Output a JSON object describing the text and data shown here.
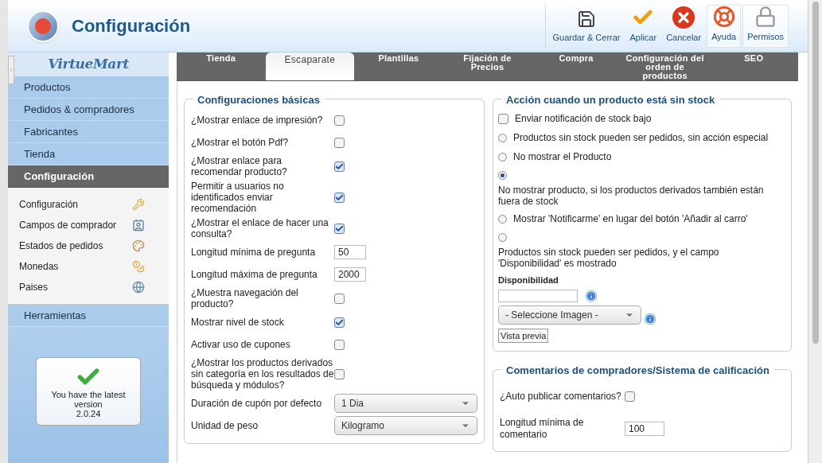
{
  "header": {
    "title": "Configuración",
    "toolbar": [
      {
        "label": "Guardar & Cerrar",
        "kind": "save"
      },
      {
        "label": "Aplicar",
        "kind": "apply"
      },
      {
        "label": "Cancelar",
        "kind": "cancel"
      },
      {
        "label": "Ayuda",
        "kind": "help"
      },
      {
        "label": "Permisos",
        "kind": "permissions"
      }
    ]
  },
  "sidebar": {
    "logo": "VirtueMart",
    "menu": [
      {
        "label": "Productos",
        "selected": false
      },
      {
        "label": "Pedidos & compradores",
        "selected": false
      },
      {
        "label": "Fabricantes",
        "selected": false
      },
      {
        "label": "Tienda",
        "selected": false
      },
      {
        "label": "Configuración",
        "selected": true,
        "children": [
          {
            "label": "Configuración",
            "kind": "tools"
          },
          {
            "label": "Campos de comprador",
            "kind": "users"
          },
          {
            "label": "Estados de pedidos",
            "kind": "status"
          },
          {
            "label": "Monedas",
            "kind": "coins"
          },
          {
            "label": "Paises",
            "kind": "globe"
          }
        ]
      },
      {
        "label": "Herramientas",
        "selected": false
      }
    ],
    "version": {
      "message": "You have the latest version",
      "number": "2.0.24"
    }
  },
  "tabs": [
    {
      "label": "Tienda",
      "selected": false
    },
    {
      "label": "Escaparate",
      "selected": true
    },
    {
      "label": "Plantillas",
      "selected": false
    },
    {
      "label": "Fijación de Precios",
      "selected": false
    },
    {
      "label": "Compra",
      "selected": false
    },
    {
      "label": "Configuración del orden de productos",
      "selected": false
    },
    {
      "label": "SEO",
      "selected": false
    }
  ],
  "basic": {
    "title": "Configuraciones básicas",
    "rows": [
      {
        "kind": "checkbox",
        "label": "¿Mostrar enlace de impresión?",
        "checked": false
      },
      {
        "kind": "checkbox",
        "label": "¿Mostrar el botón Pdf?",
        "checked": false
      },
      {
        "kind": "checkbox",
        "label": "¿Mostrar enlace para recomendar producto?",
        "checked": true
      },
      {
        "kind": "checkbox",
        "label": "Permitir a usuarios no identificados enviar recomendación",
        "checked": true
      },
      {
        "kind": "checkbox",
        "label": "¿Mostrar el enlace de hacer una consulta?",
        "checked": true
      },
      {
        "kind": "text",
        "label": "Longitud mínima de pregunta",
        "value": "50"
      },
      {
        "kind": "text",
        "label": "Longitud máxima de pregunta",
        "value": "2000"
      },
      {
        "kind": "checkbox",
        "label": "¿Muestra navegación del producto?",
        "checked": false
      },
      {
        "kind": "checkbox",
        "label": "Mostrar nivel de stock",
        "checked": true
      },
      {
        "kind": "checkbox",
        "label": "Activar uso de cupones",
        "checked": false
      },
      {
        "kind": "checkbox",
        "label": "¿Mostrar los productos derivados sin categoría en los resultados de búsqueda y módulos?",
        "checked": false
      },
      {
        "kind": "select",
        "label": "Duración de cupón por defecto",
        "value": "1 Dia"
      },
      {
        "kind": "select",
        "label": "Unidad de peso",
        "value": "Kilogramo"
      }
    ]
  },
  "stock": {
    "title": "Acción cuando un producto está sin stock",
    "options": [
      {
        "kind": "checkbox",
        "label": "Enviar notificación de stock bajo",
        "checked": false
      },
      {
        "kind": "radio",
        "label": "Productos sin stock pueden ser pedidos, sin acción especial",
        "selected": false
      },
      {
        "kind": "radio",
        "label": "No mostrar el Producto",
        "selected": false
      },
      {
        "kind": "radio_block",
        "label": "No mostrar producto, si los productos derivados también están fuera de stock",
        "selected": true
      },
      {
        "kind": "radio",
        "label": "Mostrar 'Notificarme' en lugar del botón 'Añadir al carro'",
        "selected": false
      },
      {
        "kind": "radio_block",
        "label": "Productos sin stock pueden ser pedidos, y el campo 'Disponibilidad' es mostrado",
        "selected": false
      }
    ],
    "availability_label": "Disponibilidad",
    "image_select": "- Seleccione Imagen -",
    "preview_button": "Vista previa"
  },
  "comments": {
    "title": "Comentarios de compradores/Sistema de calificación",
    "rows": [
      {
        "kind": "checkbox",
        "label": "¿Auto publicar comentarios?",
        "checked": false
      },
      {
        "kind": "text",
        "label": "Longitud mínima de comentario",
        "value": "100"
      }
    ]
  }
}
